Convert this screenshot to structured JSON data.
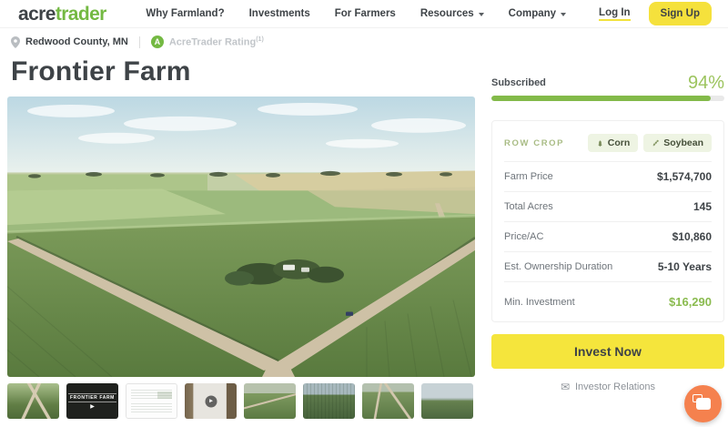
{
  "brand": {
    "logo_part1": "acre",
    "logo_part2": "trader"
  },
  "header": {
    "nav": [
      {
        "label": "Why Farmland?",
        "dropdown": false
      },
      {
        "label": "Investments",
        "dropdown": false
      },
      {
        "label": "For Farmers",
        "dropdown": false
      },
      {
        "label": "Resources",
        "dropdown": true
      },
      {
        "label": "Company",
        "dropdown": true
      }
    ],
    "login_label": "Log In",
    "signup_label": "Sign Up"
  },
  "listing": {
    "location": "Redwood County, MN",
    "rating_badge_letter": "A",
    "rating_label": "AcreTrader Rating",
    "rating_superscript": "(1)",
    "title": "Frontier Farm",
    "subscribed_label": "Subscribed",
    "subscribed_percent_text": "94%",
    "subscribed_value": 94
  },
  "details": {
    "crop_type_label": "ROW CROP",
    "crop_badges": [
      {
        "label": "Corn"
      },
      {
        "label": "Soybean"
      }
    ],
    "rows": [
      {
        "label": "Farm Price",
        "value": "$1,574,700"
      },
      {
        "label": "Total Acres",
        "value": "145"
      },
      {
        "label": "Price/AC",
        "value": "$10,860"
      },
      {
        "label": "Est. Ownership Duration",
        "value": "5-10 Years"
      }
    ],
    "min_investment_label": "Min. Investment",
    "min_investment_value": "$16,290"
  },
  "actions": {
    "invest_button_label": "Invest Now",
    "investor_relations_label": "Investor Relations",
    "mail_icon_glyph": "✉"
  },
  "gallery": {
    "video_cover_title": "FRONTIER FARM",
    "play_icon_glyph": "▶",
    "thumbnails": [
      {
        "name": "aerial-crossroads"
      },
      {
        "name": "farm-intro-video"
      },
      {
        "name": "financial-document"
      },
      {
        "name": "farmer-interview-video"
      },
      {
        "name": "aerial-field-road"
      },
      {
        "name": "aerial-crop-rows"
      },
      {
        "name": "aerial-field-roads"
      },
      {
        "name": "aerial-cloudy-horizon"
      }
    ]
  },
  "colors": {
    "brand_green": "#74b943",
    "accent_green": "#8abb4f",
    "accent_yellow": "#f5e53c",
    "chat_orange": "#f5814e",
    "text_dark": "#3e4347"
  }
}
